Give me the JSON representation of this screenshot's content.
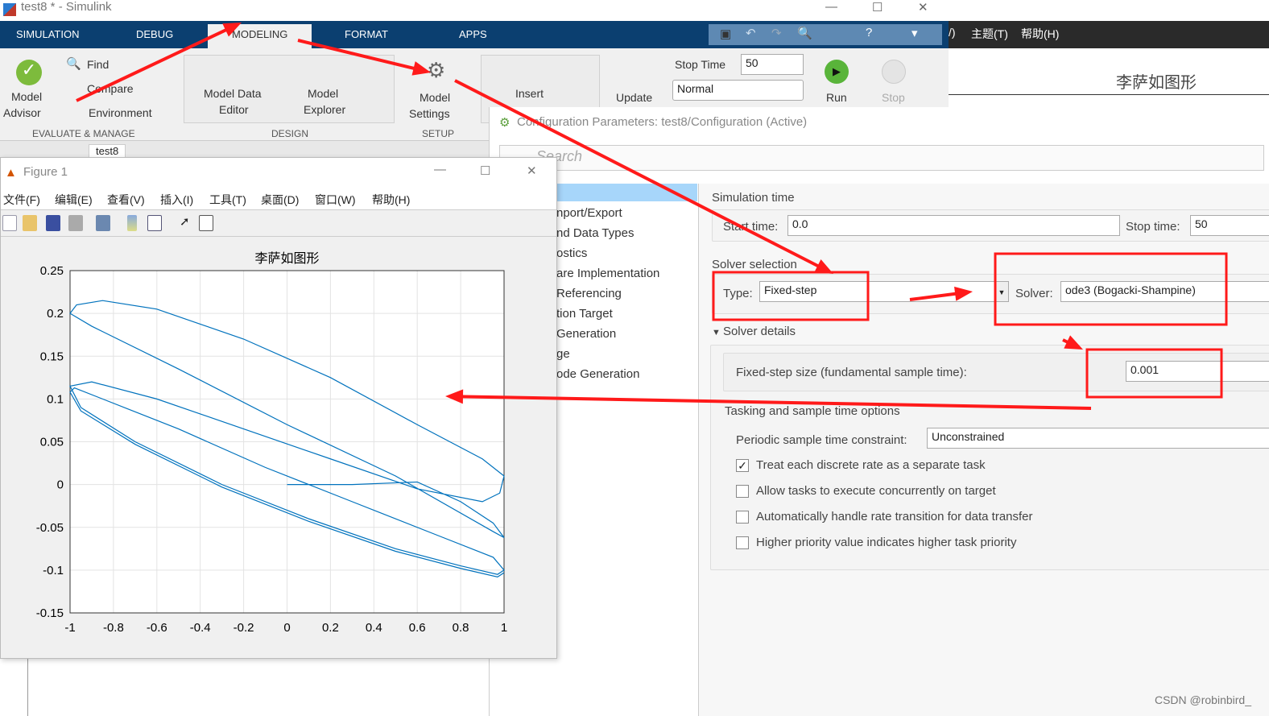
{
  "simulink": {
    "title": "test8 * - Simulink",
    "tabs": [
      "SIMULATION",
      "DEBUG",
      "MODELING",
      "FORMAT",
      "APPS"
    ],
    "active_tab": "MODELING",
    "toolstrip": {
      "model_advisor": [
        "Model",
        "Advisor"
      ],
      "find": "Find",
      "compare": "Compare",
      "environment": "Environment",
      "model_data_editor": [
        "Model Data",
        "Editor"
      ],
      "model_explorer": [
        "Model",
        "Explorer"
      ],
      "model_settings": [
        "Model",
        "Settings"
      ],
      "insert": "Insert",
      "update": "Update",
      "stop_time_label": "Stop Time",
      "stop_time_value": "50",
      "sim_mode": "Normal",
      "run": "Run",
      "stop": "Stop",
      "sections": [
        "EVALUATE & MANAGE",
        "DESIGN",
        "SETUP"
      ]
    },
    "breadcrumb_tab": "test8"
  },
  "right_window": {
    "menu": [
      "/)",
      "主题(T)",
      "帮助(H)"
    ],
    "plot_title": "李萨如图形"
  },
  "config": {
    "title": "Configuration Parameters: test8/Configuration (Active)",
    "search_placeholder": "Search",
    "tree": [
      "",
      "nport/Export",
      "nd Data Types",
      "ostics",
      "are Implementation",
      "Referencing",
      "tion Target",
      "Generation",
      "ge",
      "ode Generation"
    ],
    "simulation_time": "Simulation time",
    "start_time_label": "Start time:",
    "start_time": "0.0",
    "stop_time_label": "Stop time:",
    "stop_time": "50",
    "solver_selection": "Solver selection",
    "type_label": "Type:",
    "type_value": "Fixed-step",
    "solver_label": "Solver:",
    "solver_value": "ode3 (Bogacki-Shampine)",
    "solver_details": "Solver details",
    "step_label": "Fixed-step size (fundamental sample time):",
    "step_value": "0.001",
    "tasking": "Tasking and sample time options",
    "periodic_label": "Periodic sample time constraint:",
    "periodic_value": "Unconstrained",
    "options": [
      {
        "label": "Treat each discrete rate as a separate task",
        "checked": true
      },
      {
        "label": "Allow tasks to execute concurrently on target",
        "checked": false
      },
      {
        "label": "Automatically handle rate transition for data transfer",
        "checked": false
      },
      {
        "label": "Higher priority value indicates higher task priority",
        "checked": false
      }
    ]
  },
  "figure": {
    "title": "Figure 1",
    "menu": [
      "文件(F)",
      "编辑(E)",
      "查看(V)",
      "插入(I)",
      "工具(T)",
      "桌面(D)",
      "窗口(W)",
      "帮助(H)"
    ]
  },
  "chart_data": {
    "type": "line",
    "title": "李萨如图形",
    "xlim": [
      -1,
      1
    ],
    "ylim": [
      -0.15,
      0.25
    ],
    "grid": true,
    "color": "#0072bd",
    "xticks": [
      "-1",
      "-0.8",
      "-0.6",
      "-0.4",
      "-0.2",
      "0",
      "0.2",
      "0.4",
      "0.6",
      "0.8",
      "1"
    ],
    "yticks": [
      "0.25",
      "0.2",
      "0.15",
      "0.1",
      "0.05",
      "0",
      "-0.05",
      "-0.1",
      "-0.15"
    ],
    "points": [
      [
        0,
        0
      ],
      [
        0.3,
        0
      ],
      [
        0.6,
        0.003
      ],
      [
        0.8,
        -0.02
      ],
      [
        0.95,
        -0.045
      ],
      [
        1,
        -0.062
      ],
      [
        0.95,
        -0.055
      ],
      [
        0.5,
        0.01
      ],
      [
        0,
        0.07
      ],
      [
        -0.5,
        0.135
      ],
      [
        -0.9,
        0.185
      ],
      [
        -1,
        0.2
      ],
      [
        -0.97,
        0.21
      ],
      [
        -0.85,
        0.215
      ],
      [
        -0.6,
        0.205
      ],
      [
        -0.2,
        0.17
      ],
      [
        0.2,
        0.125
      ],
      [
        0.6,
        0.07
      ],
      [
        0.9,
        0.03
      ],
      [
        1,
        0.01
      ],
      [
        0.98,
        -0.01
      ],
      [
        0.9,
        -0.02
      ],
      [
        0.6,
        -0.005
      ],
      [
        0.2,
        0.03
      ],
      [
        -0.2,
        0.065
      ],
      [
        -0.6,
        0.1
      ],
      [
        -0.9,
        0.12
      ],
      [
        -1,
        0.115
      ],
      [
        -0.95,
        0.09
      ],
      [
        -0.7,
        0.05
      ],
      [
        -0.3,
        0
      ],
      [
        0.1,
        -0.04
      ],
      [
        0.5,
        -0.075
      ],
      [
        0.8,
        -0.095
      ],
      [
        0.97,
        -0.105
      ],
      [
        1,
        -0.1
      ],
      [
        0.95,
        -0.085
      ],
      [
        0.7,
        -0.06
      ],
      [
        0.3,
        -0.02
      ],
      [
        -0.1,
        0.02
      ],
      [
        -0.5,
        0.065
      ],
      [
        -0.85,
        0.1
      ],
      [
        -0.98,
        0.113
      ],
      [
        -1,
        0.108
      ],
      [
        -0.95,
        0.086
      ],
      [
        -0.7,
        0.047
      ],
      [
        -0.3,
        -0.003
      ],
      [
        0.1,
        -0.043
      ],
      [
        0.5,
        -0.078
      ],
      [
        0.8,
        -0.098
      ],
      [
        0.97,
        -0.108
      ],
      [
        1,
        -0.103
      ]
    ]
  },
  "annotation_color": "#ff1a1a",
  "watermark": "CSDN @robinbird_"
}
